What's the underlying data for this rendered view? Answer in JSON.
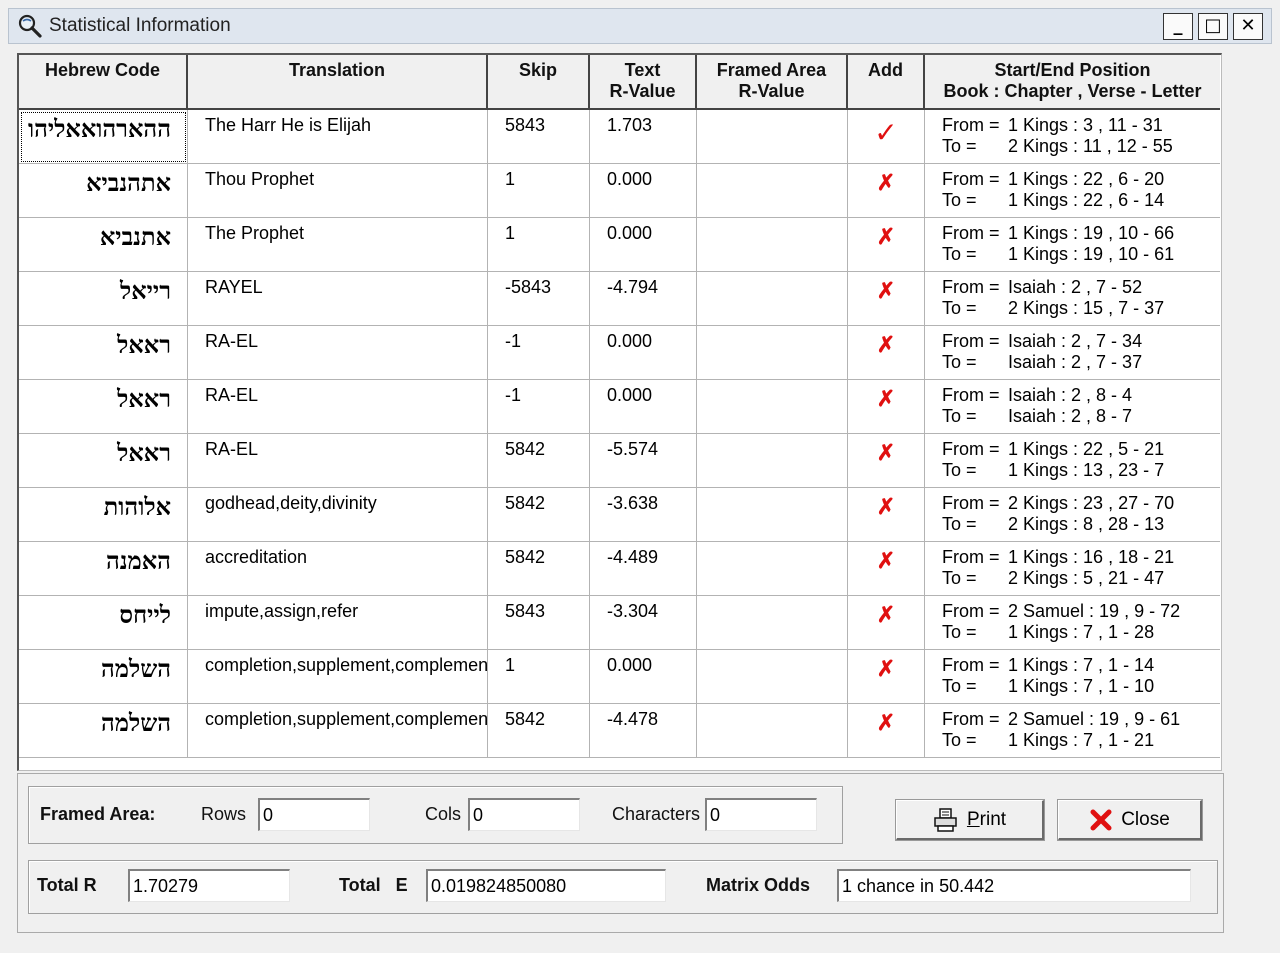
{
  "window": {
    "title": "Statistical Information",
    "minimize": "_",
    "maximize": "□",
    "close": "✕"
  },
  "table": {
    "headers": {
      "hebrew_code": "Hebrew Code",
      "translation": "Translation",
      "skip": "Skip",
      "text_rvalue_1": "Text",
      "text_rvalue_2": "R-Value",
      "framed_area_1": "Framed Area",
      "framed_area_2": "R-Value",
      "add": "Add",
      "position_1": "Start/End Position",
      "position_2": "Book : Chapter , Verse - Letter"
    },
    "from_label": "From =",
    "to_label": "To =",
    "rows": [
      {
        "hebrew": "ההארהואאליהו",
        "translation": "The Harr He is Elijah",
        "skip": "5843",
        "rvalue": "1.703",
        "framed": "",
        "add": "✓",
        "from": "1 Kings : 3 , 11 - 31",
        "to": "2 Kings : 11 , 12 - 55"
      },
      {
        "hebrew": "אתהנביא",
        "translation": "Thou Prophet",
        "skip": "1",
        "rvalue": "0.000",
        "framed": "",
        "add": "✗",
        "from": "1 Kings : 22 , 6 - 20",
        "to": "1 Kings : 22 , 6 - 14"
      },
      {
        "hebrew": "אתנביא",
        "translation": "The Prophet",
        "skip": "1",
        "rvalue": "0.000",
        "framed": "",
        "add": "✗",
        "from": "1 Kings : 19 , 10 - 66",
        "to": "1 Kings : 19 , 10 - 61"
      },
      {
        "hebrew": "רייאל",
        "translation": "RAYEL",
        "skip": "-5843",
        "rvalue": "-4.794",
        "framed": "",
        "add": "✗",
        "from": "Isaiah : 2 , 7 - 52",
        "to": "2 Kings : 15 , 7 - 37"
      },
      {
        "hebrew": "ראאל",
        "translation": "RA-EL",
        "skip": "-1",
        "rvalue": "0.000",
        "framed": "",
        "add": "✗",
        "from": "Isaiah : 2 , 7 - 34",
        "to": "Isaiah : 2 , 7 - 37"
      },
      {
        "hebrew": "ראאל",
        "translation": "RA-EL",
        "skip": "-1",
        "rvalue": "0.000",
        "framed": "",
        "add": "✗",
        "from": "Isaiah : 2 , 8 - 4",
        "to": "Isaiah : 2 , 8 - 7"
      },
      {
        "hebrew": "ראאל",
        "translation": "RA-EL",
        "skip": "5842",
        "rvalue": "-5.574",
        "framed": "",
        "add": "✗",
        "from": "1 Kings : 22 , 5 - 21",
        "to": "1 Kings : 13 , 23 - 7"
      },
      {
        "hebrew": "אלוהות",
        "translation": "godhead,deity,divinity",
        "skip": "5842",
        "rvalue": "-3.638",
        "framed": "",
        "add": "✗",
        "from": "2 Kings : 23 , 27 - 70",
        "to": "2 Kings : 8 , 28 - 13"
      },
      {
        "hebrew": "האמנה",
        "translation": "accreditation",
        "skip": "5842",
        "rvalue": "-4.489",
        "framed": "",
        "add": "✗",
        "from": "1 Kings : 16 , 18 - 21",
        "to": "2 Kings : 5 , 21 - 47"
      },
      {
        "hebrew": "לייחס",
        "translation": "impute,assign,refer",
        "skip": "5843",
        "rvalue": "-3.304",
        "framed": "",
        "add": "✗",
        "from": "2 Samuel : 19 , 9 - 72",
        "to": "1 Kings : 7 , 1 - 28"
      },
      {
        "hebrew": "השלמה",
        "translation": "completion,supplement,complement,",
        "skip": "1",
        "rvalue": "0.000",
        "framed": "",
        "add": "✗",
        "from": "1 Kings : 7 , 1 - 14",
        "to": "1 Kings : 7 , 1 - 10"
      },
      {
        "hebrew": "השלמה",
        "translation": "completion,supplement,complement,",
        "skip": "5842",
        "rvalue": "-4.478",
        "framed": "",
        "add": "✗",
        "from": "2 Samuel : 19 , 9 - 61",
        "to": "1 Kings : 7 , 1 - 21"
      }
    ]
  },
  "framed_area": {
    "label": "Framed Area:",
    "rows_label": "Rows",
    "rows_value": "0",
    "cols_label": "Cols",
    "cols_value": "0",
    "chars_label": "Characters",
    "chars_value": "0"
  },
  "buttons": {
    "print_p": "P",
    "print_rest": "rint",
    "close": "Close"
  },
  "totals": {
    "total_r_label": "Total R",
    "total_r_value": "1.70279",
    "total_e_label": "Total   E",
    "total_e_value": "0.019824850080",
    "odds_label": "Matrix Odds",
    "odds_value": "1 chance in 50.442"
  },
  "colors": {
    "accent_red": "#e01010",
    "titlebar": "#dfe6ef"
  },
  "icons": {
    "app": "magnifier-icon",
    "print": "printer-icon",
    "close": "red-x-icon",
    "add_yes": "checkmark-icon",
    "add_no": "x-mark-icon"
  }
}
